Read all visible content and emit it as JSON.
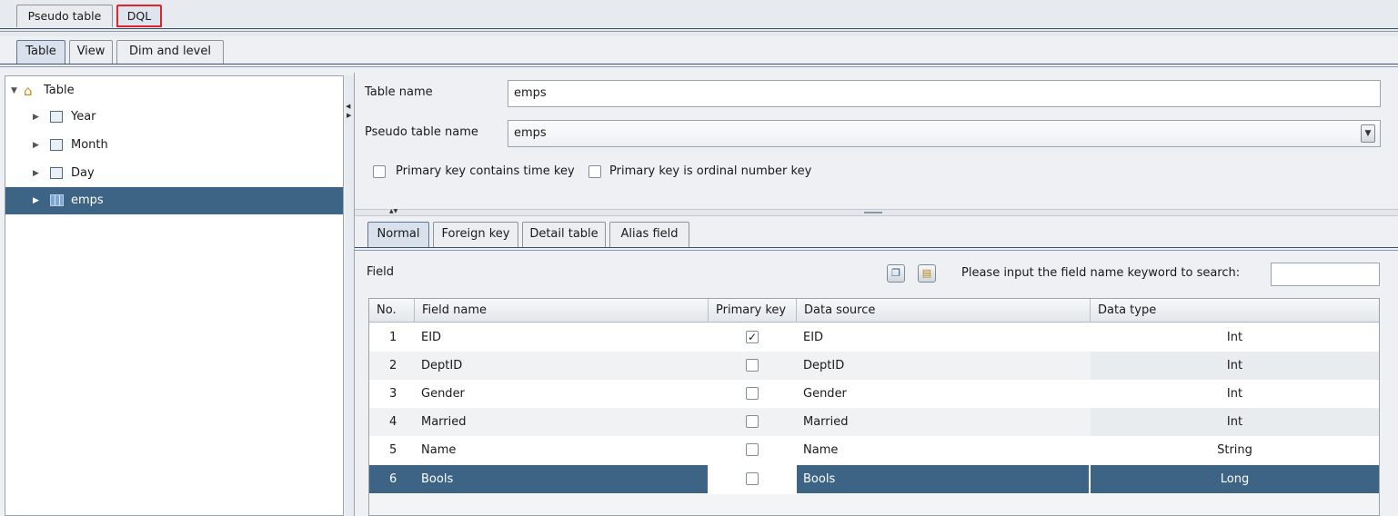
{
  "top_tabs": [
    {
      "label": "Pseudo table"
    },
    {
      "label": "DQL"
    }
  ],
  "sub_tabs": [
    {
      "label": "Table"
    },
    {
      "label": "View"
    },
    {
      "label": "Dim and level"
    }
  ],
  "tree": {
    "root": {
      "label": "Table",
      "icon": "home-icon"
    },
    "items": [
      {
        "label": "Year",
        "icon": "table-icon"
      },
      {
        "label": "Month",
        "icon": "table-icon"
      },
      {
        "label": "Day",
        "icon": "table-icon"
      },
      {
        "label": "emps",
        "icon": "grid-table-icon",
        "selected": true
      }
    ]
  },
  "form": {
    "table_name_label": "Table name",
    "table_name_value": "emps",
    "pseudo_label": "Pseudo table name",
    "pseudo_value": "emps",
    "cb_time_key": "Primary key contains time key",
    "cb_ordinal_key": "Primary key is ordinal number key"
  },
  "detail_tabs": [
    {
      "label": "Normal"
    },
    {
      "label": "Foreign key"
    },
    {
      "label": "Detail table"
    },
    {
      "label": "Alias field"
    }
  ],
  "field_section": {
    "title": "Field",
    "search_label": "Please input the field name keyword to search:",
    "search_value": ""
  },
  "grid": {
    "headers": {
      "no": "No.",
      "name": "Field name",
      "pk": "Primary key",
      "src": "Data source",
      "type": "Data type"
    },
    "rows": [
      {
        "no": "1",
        "name": "EID",
        "pk": true,
        "src": "EID",
        "type": "Int"
      },
      {
        "no": "2",
        "name": "DeptID",
        "pk": false,
        "src": "DeptID",
        "type": "Int"
      },
      {
        "no": "3",
        "name": "Gender",
        "pk": false,
        "src": "Gender",
        "type": "Int"
      },
      {
        "no": "4",
        "name": "Married",
        "pk": false,
        "src": "Married",
        "type": "Int"
      },
      {
        "no": "5",
        "name": "Name",
        "pk": false,
        "src": "Name",
        "type": "String"
      },
      {
        "no": "6",
        "name": "Bools",
        "pk": false,
        "src": "Bools",
        "type": "Long",
        "selected": true
      }
    ]
  },
  "colors": {
    "selection": "#3d6484",
    "highlight_border": "#e0242b"
  }
}
